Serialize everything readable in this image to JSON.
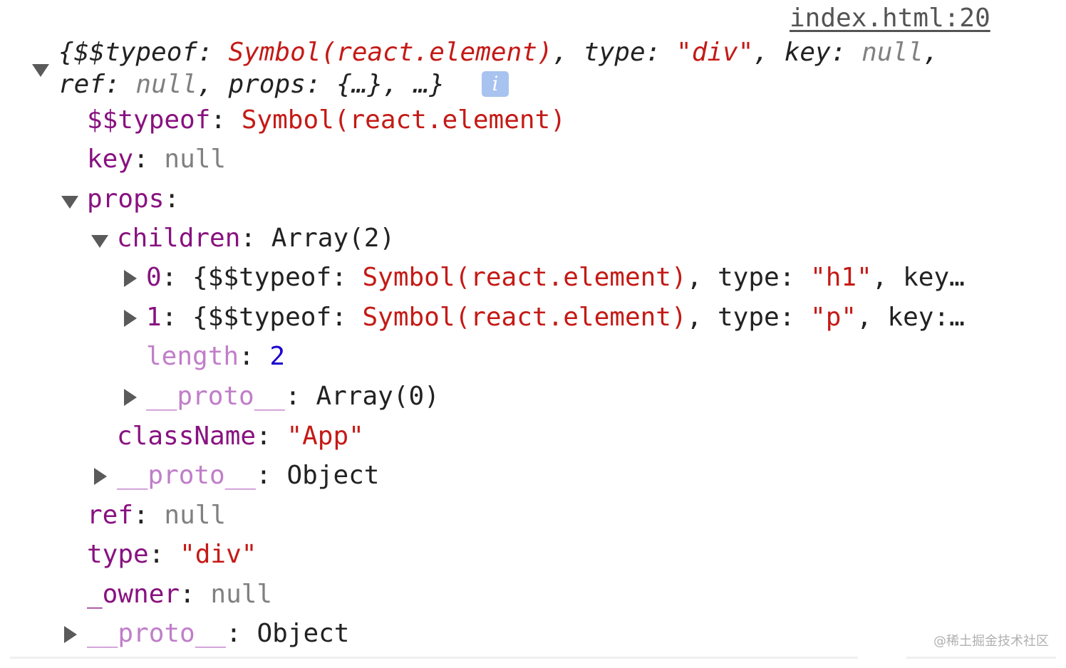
{
  "source_link": "index.html:20",
  "summary": {
    "open_brace": "{",
    "typeof_key": "$$typeof",
    "colon": ": ",
    "typeof_val": "Symbol(react.element)",
    "sep": ", ",
    "type_key": "type",
    "type_val": "\"div\"",
    "key_key": "key",
    "key_val": "null",
    "trailing_comma": ",",
    "ref_key": "ref",
    "ref_val": "null",
    "props_key": "props",
    "props_val": "{…}",
    "more": "…}",
    "info_icon": "i"
  },
  "tree": {
    "typeof": {
      "key": "$$typeof",
      "value": "Symbol(react.element)"
    },
    "key": {
      "key": "key",
      "value": "null"
    },
    "props": {
      "key": "props",
      "children": {
        "key": "children",
        "value": "Array(2)",
        "items": [
          {
            "index": "0",
            "open": "{",
            "typeof_key": "$$typeof",
            "typeof_val": "Symbol(react.element)",
            "type_key": "type",
            "type_val": "\"h1\"",
            "tail": "key…"
          },
          {
            "index": "1",
            "open": "{",
            "typeof_key": "$$typeof",
            "typeof_val": "Symbol(react.element)",
            "type_key": "type",
            "type_val": "\"p\"",
            "tail": "key:…"
          }
        ],
        "length_key": "length",
        "length_val": "2",
        "proto_key": "__proto__",
        "proto_val": "Array(0)"
      },
      "className_key": "className",
      "className_val": "\"App\"",
      "proto_key": "__proto__",
      "proto_val": "Object"
    },
    "ref": {
      "key": "ref",
      "value": "null"
    },
    "type": {
      "key": "type",
      "value": "\"div\""
    },
    "owner": {
      "key": "_owner",
      "value": "null"
    },
    "proto": {
      "key": "__proto__",
      "value": "Object"
    }
  },
  "watermark": "@稀土掘金技术社区",
  "colors": {
    "key": "#881280",
    "string": "#c41a16",
    "number": "#1c00cf",
    "null": "#808080",
    "info_badge": "#a8c3ef"
  }
}
